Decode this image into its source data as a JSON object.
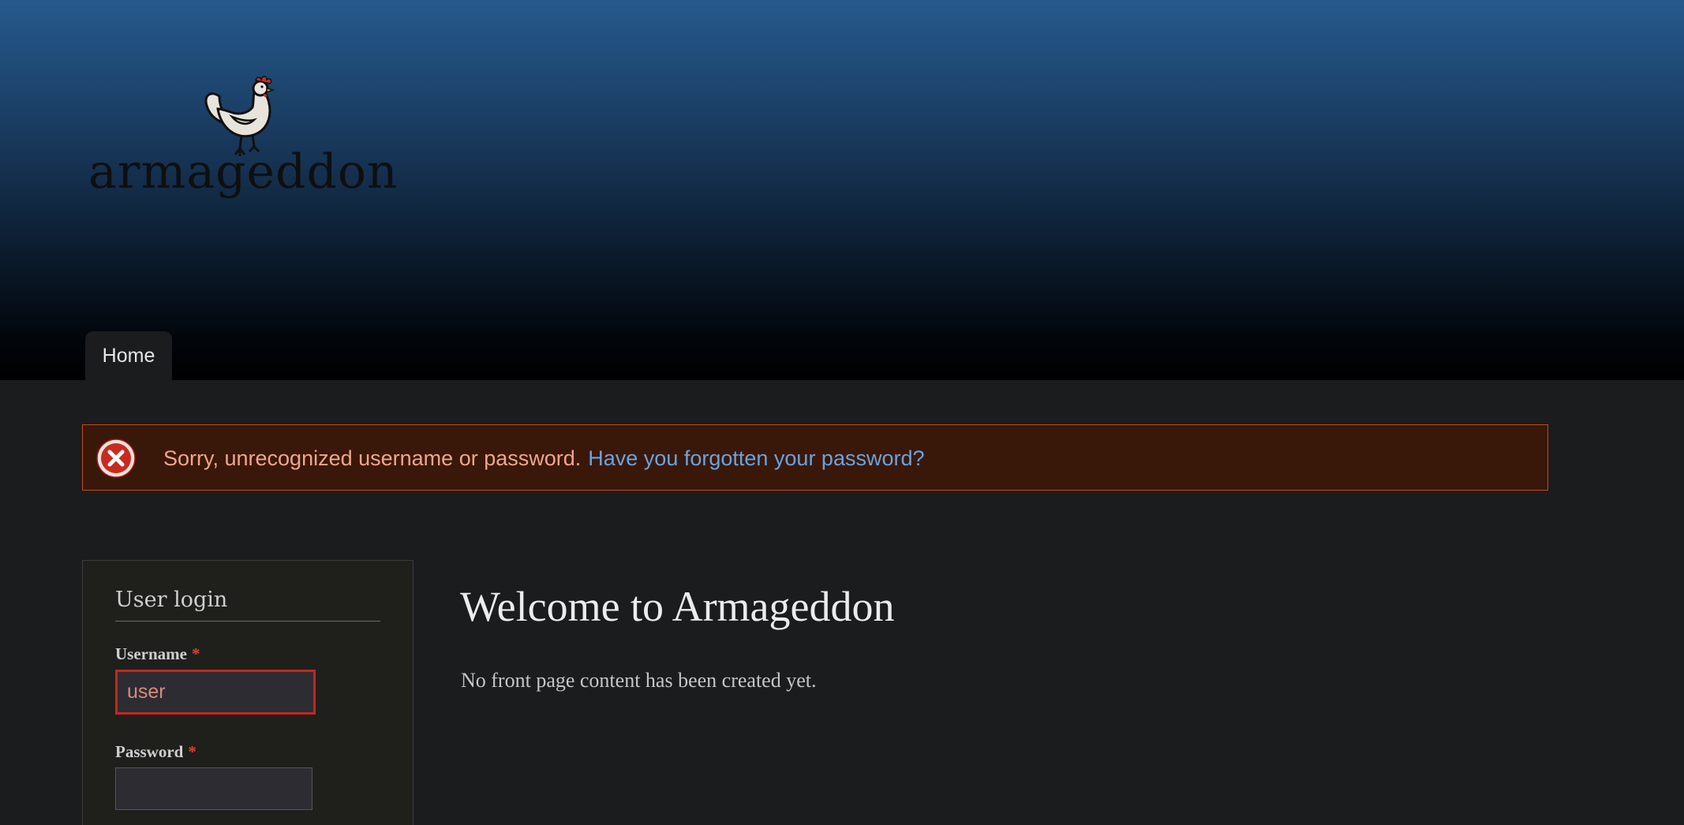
{
  "site": {
    "name": "armageddon",
    "logo_icon": "rooster-logo-icon"
  },
  "nav": {
    "tabs": [
      {
        "label": "Home"
      }
    ]
  },
  "messages": {
    "icon": "error-icon",
    "text": "Sorry, unrecognized username or password.",
    "link_text": "Have you forgotten your password?",
    "colors": {
      "background": "#3a1809",
      "border": "#c14a1b",
      "text": "#f1a58e",
      "link": "#6aa3df"
    }
  },
  "sidebar": {
    "login_block": {
      "title": "User login",
      "username_label": "Username",
      "username_value": "user",
      "password_label": "Password",
      "password_value": "",
      "required_marker": "*"
    }
  },
  "main": {
    "title": "Welcome to Armageddon",
    "text": "No front page content has been created yet."
  },
  "colors": {
    "header_gradient_top": "#265a8d",
    "header_gradient_bottom": "#000000",
    "body_background": "#1b1c1e",
    "error_border": "#c2281e"
  }
}
